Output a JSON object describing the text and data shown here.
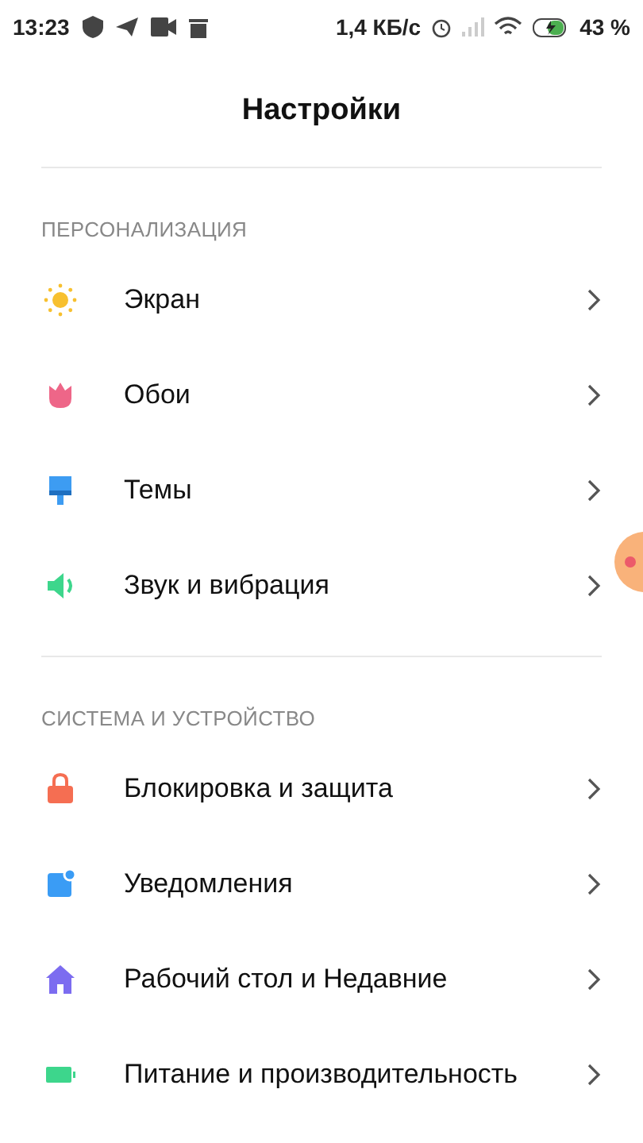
{
  "status_bar": {
    "time": "13:23",
    "speed": "1,4 КБ/с",
    "battery": "43 %"
  },
  "title": "Настройки",
  "sections": [
    {
      "header": "ПЕРСОНАЛИЗАЦИЯ",
      "items": [
        {
          "label": "Экран",
          "color": "#f7c02f"
        },
        {
          "label": "Обои",
          "color": "#ee6688"
        },
        {
          "label": "Темы",
          "color": "#3d9cf2"
        },
        {
          "label": "Звук и вибрация",
          "color": "#3dd68c"
        }
      ]
    },
    {
      "header": "СИСТЕМА И УСТРОЙСТВО",
      "items": [
        {
          "label": "Блокировка и защита",
          "color": "#f56e52"
        },
        {
          "label": "Уведомления",
          "color": "#3a9cf5"
        },
        {
          "label": "Рабочий стол и Недавние",
          "color": "#7c6cf0"
        },
        {
          "label": "Питание и производительность",
          "color": "#3dd68c"
        }
      ]
    }
  ]
}
